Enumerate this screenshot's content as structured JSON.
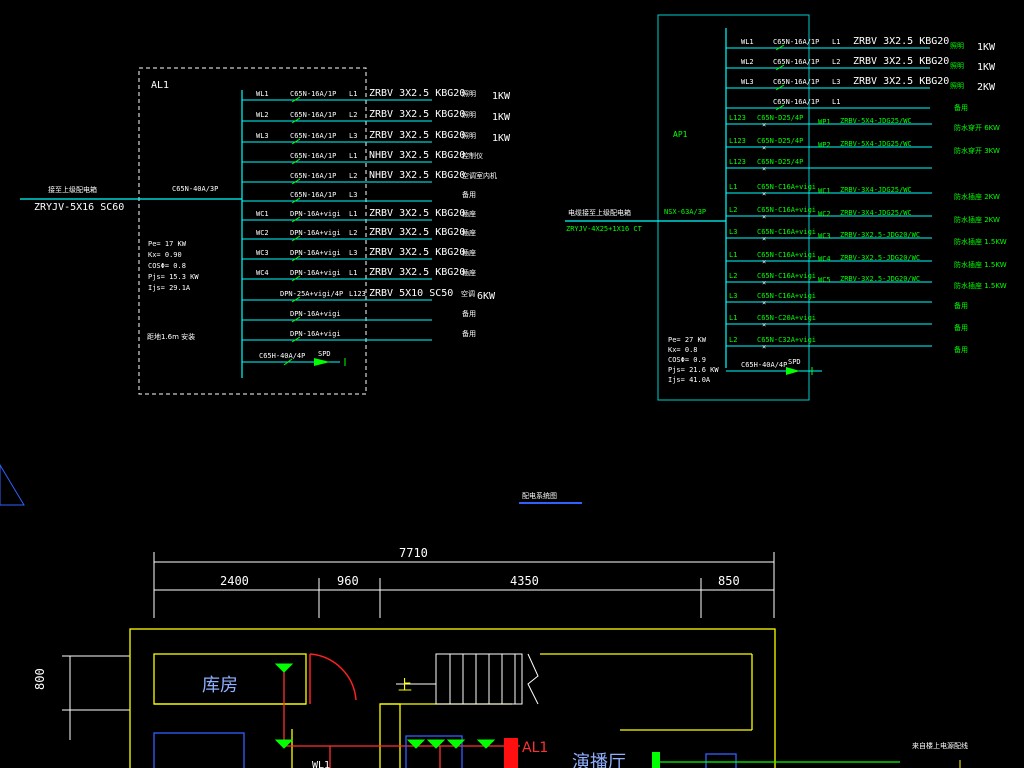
{
  "al1": {
    "title": "AL1",
    "incoming_label": "接至上级配电箱",
    "incoming_cable": "ZRYJV-5X16  SC60",
    "main_breaker": "C65N-40A/3P",
    "params": [
      "Pe= 17  KW",
      "Kx= 0.90",
      "COSΦ= 0.8",
      "Pjs= 15.3 KW",
      "Ijs= 29.1A"
    ],
    "install_note": "距地1.6m 安装",
    "rows": [
      {
        "circuit": "WL1",
        "breaker": "C65N-16A/1P",
        "phase": "L1",
        "cable": "ZRBV 3X2.5 KBG20",
        "use": "照明",
        "load": "1KW"
      },
      {
        "circuit": "WL2",
        "breaker": "C65N-16A/1P",
        "phase": "L2",
        "cable": "ZRBV 3X2.5 KBG20",
        "use": "照明",
        "load": "1KW"
      },
      {
        "circuit": "WL3",
        "breaker": "C65N-16A/1P",
        "phase": "L3",
        "cable": "ZRBV 3X2.5 KBG20",
        "use": "照明",
        "load": "1KW"
      },
      {
        "circuit": "",
        "breaker": "C65N-16A/1P",
        "phase": "L1",
        "cable": "NHBV 3X2.5 KBG20",
        "use": "控制仪",
        "load": ""
      },
      {
        "circuit": "",
        "breaker": "C65N-16A/1P",
        "phase": "L2",
        "cable": "NHBV 3X2.5 KBG20",
        "use": "空调室内机",
        "load": ""
      },
      {
        "circuit": "",
        "breaker": "C65N-16A/1P",
        "phase": "L3",
        "cable": "",
        "use": "备用",
        "load": ""
      },
      {
        "circuit": "WC1",
        "breaker": "DPN-16A+vigi",
        "phase": "L1",
        "cable": "ZRBV 3X2.5 KBG20",
        "use": "插座",
        "load": ""
      },
      {
        "circuit": "WC2",
        "breaker": "DPN-16A+vigi",
        "phase": "L2",
        "cable": "ZRBV 3X2.5 KBG20",
        "use": "插座",
        "load": ""
      },
      {
        "circuit": "WC3",
        "breaker": "DPN-16A+vigi",
        "phase": "L3",
        "cable": "ZRBV 3X2.5 KBG20",
        "use": "插座",
        "load": ""
      },
      {
        "circuit": "WC4",
        "breaker": "DPN-16A+vigi",
        "phase": "L1",
        "cable": "ZRBV 3X2.5 KBG20",
        "use": "插座",
        "load": ""
      },
      {
        "circuit": "",
        "breaker": "DPN-25A+vigi/4P",
        "phase": "L123",
        "cable": "ZRBV 5X10  SC50",
        "use": "空调",
        "load": "6KW"
      },
      {
        "circuit": "",
        "breaker": "DPN-16A+vigi",
        "phase": "",
        "cable": "",
        "use": "备用",
        "load": ""
      },
      {
        "circuit": "",
        "breaker": "DPN-16A+vigi",
        "phase": "",
        "cable": "",
        "use": "备用",
        "load": ""
      }
    ],
    "spd_breaker": "C65H-40A/4P",
    "spd_label": "SPD"
  },
  "ap1": {
    "title": "AP1",
    "incoming_label": "电缆接至上级配电箱",
    "incoming_cable": "ZRYJV-4X25+1X16 CT",
    "main_breaker": "NSX-63A/3P",
    "params": [
      "Pe= 27  KW",
      "Kx= 0.8",
      "COSΦ= 0.9",
      "Pjs= 21.6  KW",
      "Ijs= 41.0A"
    ],
    "top_rows": [
      {
        "circuit": "WL1",
        "breaker": "C65N-16A/1P",
        "phase": "L1",
        "cable": "ZRBV 3X2.5 KBG20",
        "use": "照明",
        "load": "1KW"
      },
      {
        "circuit": "WL2",
        "breaker": "C65N-16A/1P",
        "phase": "L2",
        "cable": "ZRBV 3X2.5 KBG20",
        "use": "照明",
        "load": "1KW"
      },
      {
        "circuit": "WL3",
        "breaker": "C65N-16A/1P",
        "phase": "L3",
        "cable": "ZRBV 3X2.5 KBG20",
        "use": "照明",
        "load": "2KW"
      },
      {
        "circuit": "",
        "breaker": "C65N-16A/1P",
        "phase": "L1",
        "cable": "",
        "use": "备用",
        "load": ""
      }
    ],
    "rows": [
      {
        "phase": "L123",
        "breaker": "C65N-D25/4P",
        "circuit": "WP1",
        "cable": "ZRBV-5X4-JDG25/WC",
        "use": "防水穿开 6KW"
      },
      {
        "phase": "L123",
        "breaker": "C65N-D25/4P",
        "circuit": "WP2",
        "cable": "ZRBV-5X4-JDG25/WC",
        "use": "防水穿开 3KW"
      },
      {
        "phase": "L123",
        "breaker": "C65N-D25/4P",
        "circuit": "",
        "cable": "",
        "use": ""
      },
      {
        "phase": "L1",
        "breaker": "C65N-C16A+vigi",
        "circuit": "WC1",
        "cable": "ZRBV-3X4-JDG25/WC",
        "use": "防水插座 2KW"
      },
      {
        "phase": "L2",
        "breaker": "C65N-C16A+vigi",
        "circuit": "WC2",
        "cable": "ZRBV-3X4-JDG25/WC",
        "use": "防水插座 2KW"
      },
      {
        "phase": "L3",
        "breaker": "C65N-C16A+vigi",
        "circuit": "WC3",
        "cable": "ZRBV-3X2.5-JDG20/WC",
        "use": "防水插座 1.5KW"
      },
      {
        "phase": "L1",
        "breaker": "C65N-C16A+vigi",
        "circuit": "WC4",
        "cable": "ZRBV-3X2.5-JDG20/WC",
        "use": "防水插座 1.5KW"
      },
      {
        "phase": "L2",
        "breaker": "C65N-C16A+vigi",
        "circuit": "WC5",
        "cable": "ZRBV-3X2.5-JDG20/WC",
        "use": "防水插座 1.5KW"
      },
      {
        "phase": "L3",
        "breaker": "C65N-C16A+vigi",
        "circuit": "",
        "cable": "",
        "use": "备用"
      },
      {
        "phase": "L1",
        "breaker": "C65N-C20A+vigi",
        "circuit": "",
        "cable": "",
        "use": "备用"
      },
      {
        "phase": "L2",
        "breaker": "C65N-C32A+vigi",
        "circuit": "",
        "cable": "",
        "use": "备用"
      }
    ],
    "spd_breaker": "C65H-40A/4P",
    "spd_label": "SPD"
  },
  "caption": "配电系统图",
  "plan": {
    "dim_total": "7710",
    "dims": [
      "2400",
      "960",
      "4350",
      "850"
    ],
    "dim_side": "800",
    "room1": "库房",
    "room2": "演播厅",
    "stair_label": "上",
    "panel_label": "AL1",
    "wire_label": "WL1",
    "right_note": "来自楼上电源配线"
  },
  "colors": {
    "cyan": "#00ffff",
    "green": "#00ff00",
    "yellow": "#ffff00",
    "red": "#ff0000",
    "blue": "#3060ff",
    "white": "#ffffff"
  }
}
